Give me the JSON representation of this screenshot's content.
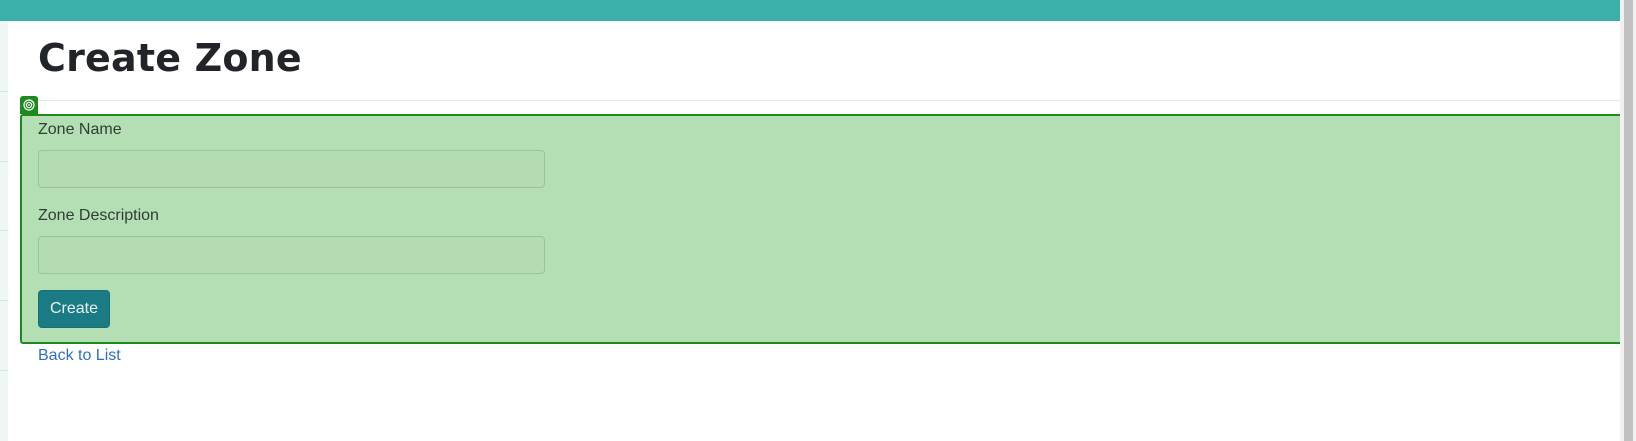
{
  "header": {
    "title": "Create Zone"
  },
  "form": {
    "zone_name_label": "Zone Name",
    "zone_name_value": "",
    "zone_description_label": "Zone Description",
    "zone_description_value": "",
    "create_label": "Create"
  },
  "footer": {
    "back_link_label": "Back to List"
  },
  "colors": {
    "top_bar": "#3bb0a9",
    "highlight_fill": "#b3dcb3",
    "highlight_border": "#1e8a1e",
    "button": "#1a7b84",
    "link": "#2f6fc7"
  },
  "icons": {
    "highlight_badge": "target-icon"
  }
}
